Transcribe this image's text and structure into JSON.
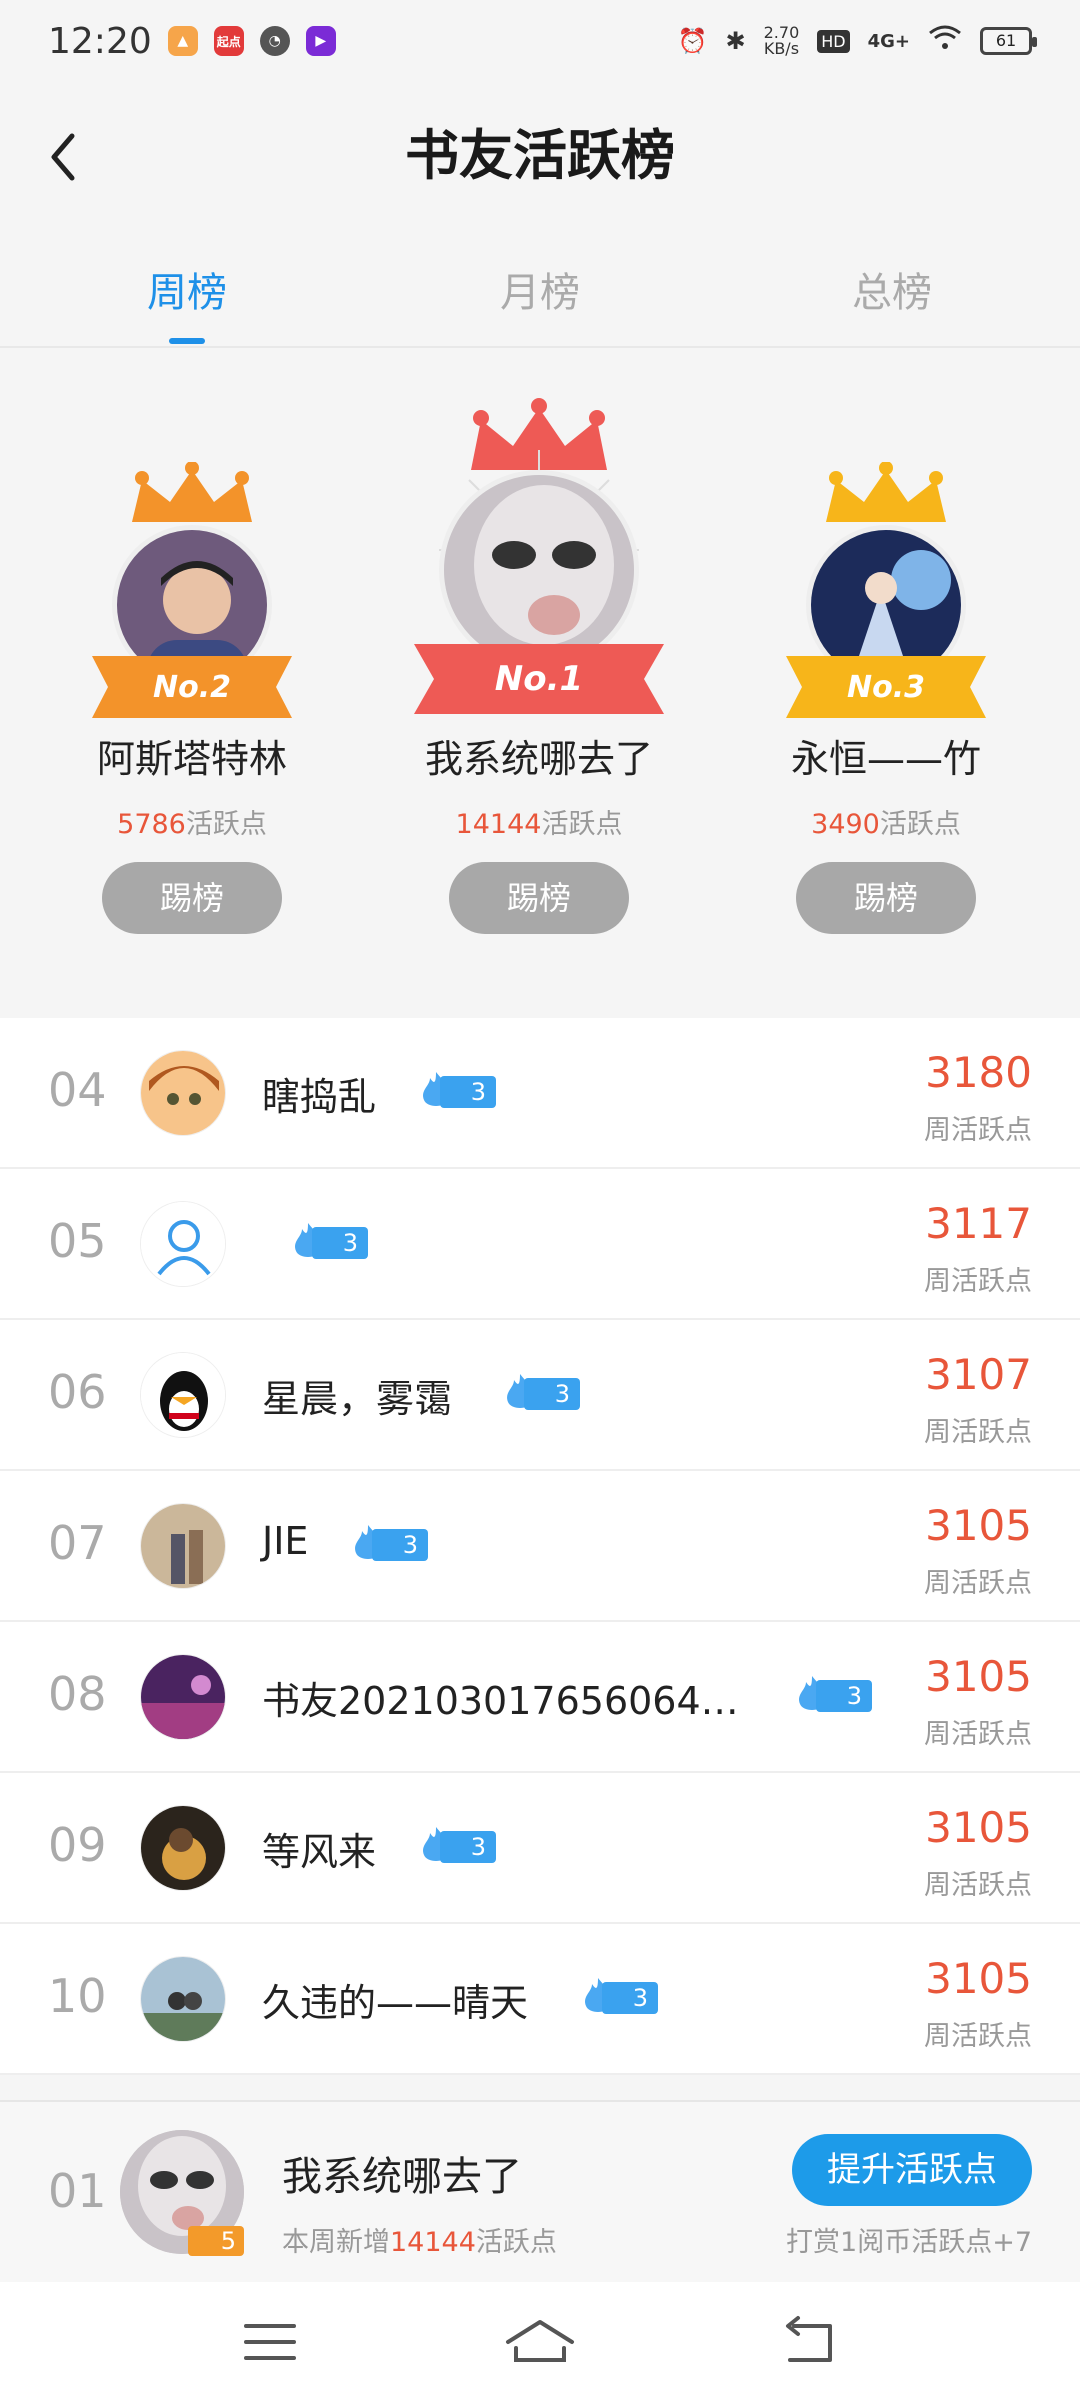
{
  "status_bar": {
    "time": "12:20",
    "speed_value": "2.70",
    "speed_unit": "KB/s",
    "hd": "HD",
    "network": "4G+",
    "battery": "61",
    "noti_label": "起点"
  },
  "header": {
    "title": "书友活跃榜"
  },
  "tabs": [
    {
      "label": "周榜",
      "active": true
    },
    {
      "label": "月榜",
      "active": false
    },
    {
      "label": "总榜",
      "active": false
    }
  ],
  "podium": {
    "first": {
      "rank_label": "No.1",
      "name": "我系统哪去了",
      "points": "14144",
      "points_suffix": "活跃点",
      "button": "踢榜"
    },
    "second": {
      "rank_label": "No.2",
      "name": "阿斯塔特林",
      "points": "5786",
      "points_suffix": "活跃点",
      "button": "踢榜"
    },
    "third": {
      "rank_label": "No.3",
      "name": "永恒——竹",
      "points": "3490",
      "points_suffix": "活跃点",
      "button": "踢榜"
    }
  },
  "list": [
    {
      "rank": "04",
      "name": "瞎捣乱",
      "level": "3",
      "points": "3180",
      "label": "周活跃点"
    },
    {
      "rank": "05",
      "name": "",
      "level": "3",
      "points": "3117",
      "label": "周活跃点"
    },
    {
      "rank": "06",
      "name": "星晨，雾霭",
      "level": "3",
      "points": "3107",
      "label": "周活跃点"
    },
    {
      "rank": "07",
      "name": "JIE",
      "level": "3",
      "points": "3105",
      "label": "周活跃点"
    },
    {
      "rank": "08",
      "name": "书友20210301765606​4…",
      "level": "3",
      "points": "3105",
      "label": "周活跃点"
    },
    {
      "rank": "09",
      "name": "等风来",
      "level": "3",
      "points": "3105",
      "label": "周活跃点"
    },
    {
      "rank": "10",
      "name": "久违的——晴天",
      "level": "3",
      "points": "3105",
      "label": "周活跃点"
    }
  ],
  "me": {
    "rank": "01",
    "name": "我系统哪去了",
    "level": "5",
    "sub_prefix": "本周新增",
    "sub_points": "14144",
    "sub_suffix": "活跃点",
    "button": "提升活跃点",
    "tip": "打赏1阅币活跃点+7"
  },
  "colors": {
    "accent": "#1e90e8",
    "points": "#e8563a",
    "gold": "#f7b51a",
    "orange": "#f3932a",
    "red": "#ee5a55"
  }
}
